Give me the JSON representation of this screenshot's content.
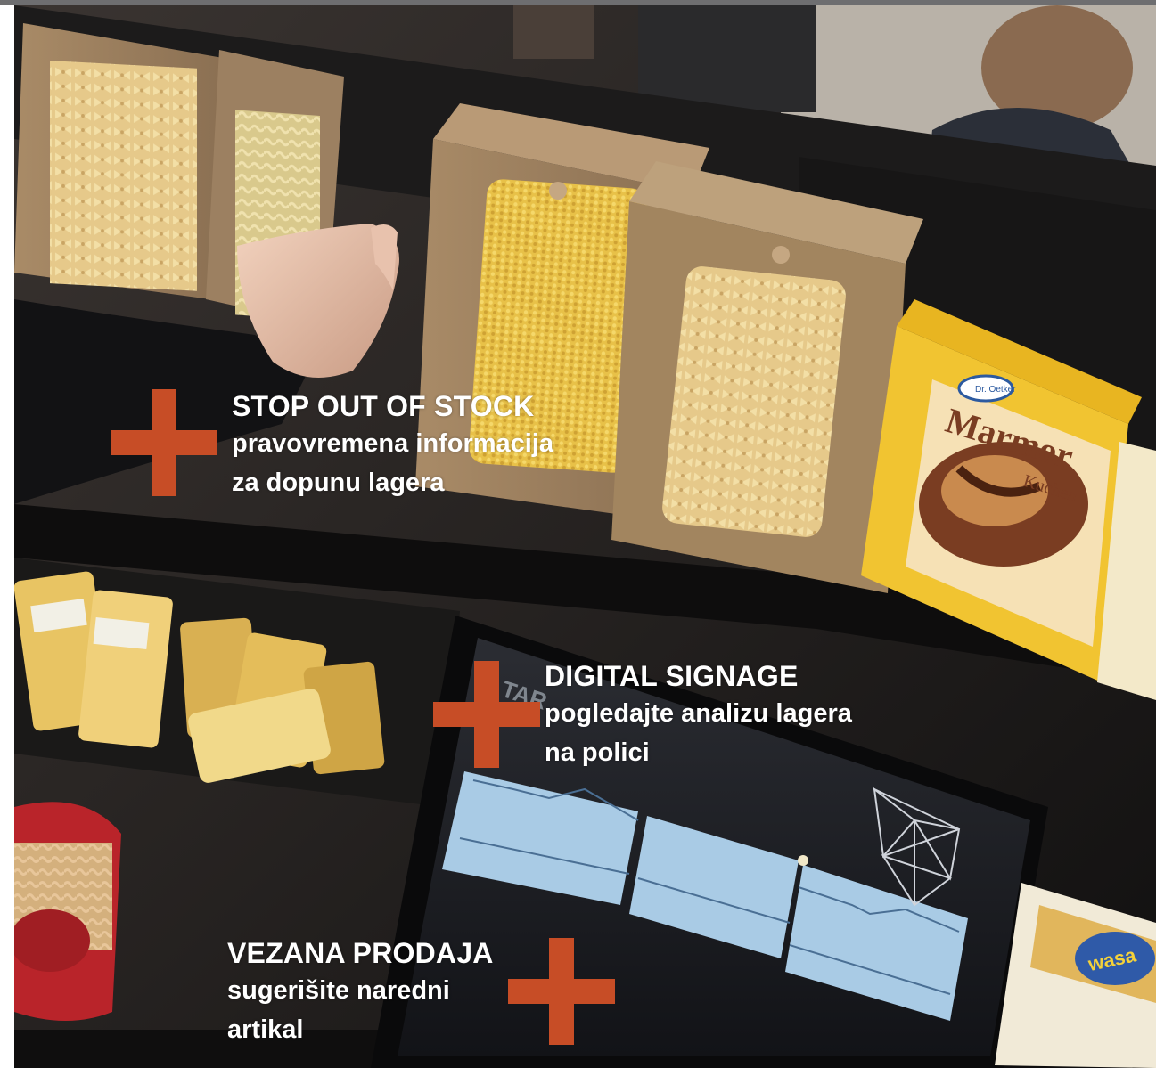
{
  "accent": "#c74d26",
  "callouts": [
    {
      "title": "STOP OUT OF STOCK",
      "line1": "pravovremena informacija",
      "line2": "za dopunu lagera"
    },
    {
      "title": "DIGITAL SIGNAGE",
      "line1": "pogledajte analizu lagera",
      "line2": "na polici"
    },
    {
      "title": "VEZANA PRODAJA",
      "line1": "sugerišite naredni",
      "line2": "artikal"
    }
  ],
  "product_box": {
    "brand": "Dr. Oetker",
    "name": "Marmor",
    "sub": "Kuchen"
  },
  "cracker_box": {
    "brand": "wasa"
  }
}
